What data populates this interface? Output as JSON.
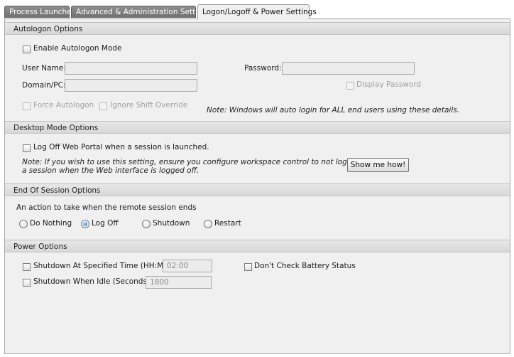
{
  "tabs": [
    {
      "label": "Process Launcher"
    },
    {
      "label": "Advanced & Administration Settings"
    },
    {
      "label": "Logon/Logoff & Power Settings"
    }
  ],
  "autologon": {
    "header": "Autologon Options",
    "enable_label": "Enable Autologon Mode",
    "username_label": "User Name:",
    "username_value": "",
    "password_label": "Password:",
    "password_value": "",
    "domain_label": "Domain/PC:",
    "domain_value": "",
    "display_password_label": "Display Password",
    "force_autologon_label": "Force Autologon",
    "ignore_shift_label": "Ignore Shift Override",
    "note": "Note: Windows will auto login for ALL end users using these details."
  },
  "desktop": {
    "header": "Desktop Mode Options",
    "logoff_label": "Log Off Web Portal when a session is launched.",
    "note_line1": "Note: If you wish to use this setting, ensure you configure workspace control to not log off",
    "note_line2": "a session when the Web interface is logged off.",
    "show_button": "Show me how!"
  },
  "session": {
    "header": "End Of Session Options",
    "prompt": "An action to take when the remote session ends",
    "options": [
      {
        "label": "Do Nothing"
      },
      {
        "label": "Log Off"
      },
      {
        "label": "Shutdown"
      },
      {
        "label": "Restart"
      }
    ],
    "selected": "Log Off"
  },
  "power": {
    "header": "Power Options",
    "shutdown_time_label": "Shutdown At Specified Time (HH:MM):",
    "shutdown_time_value": "02:00",
    "battery_label": "Don't Check Battery Status",
    "shutdown_idle_label": "Shutdown When Idle (Seconds):",
    "shutdown_idle_value": "1800"
  }
}
